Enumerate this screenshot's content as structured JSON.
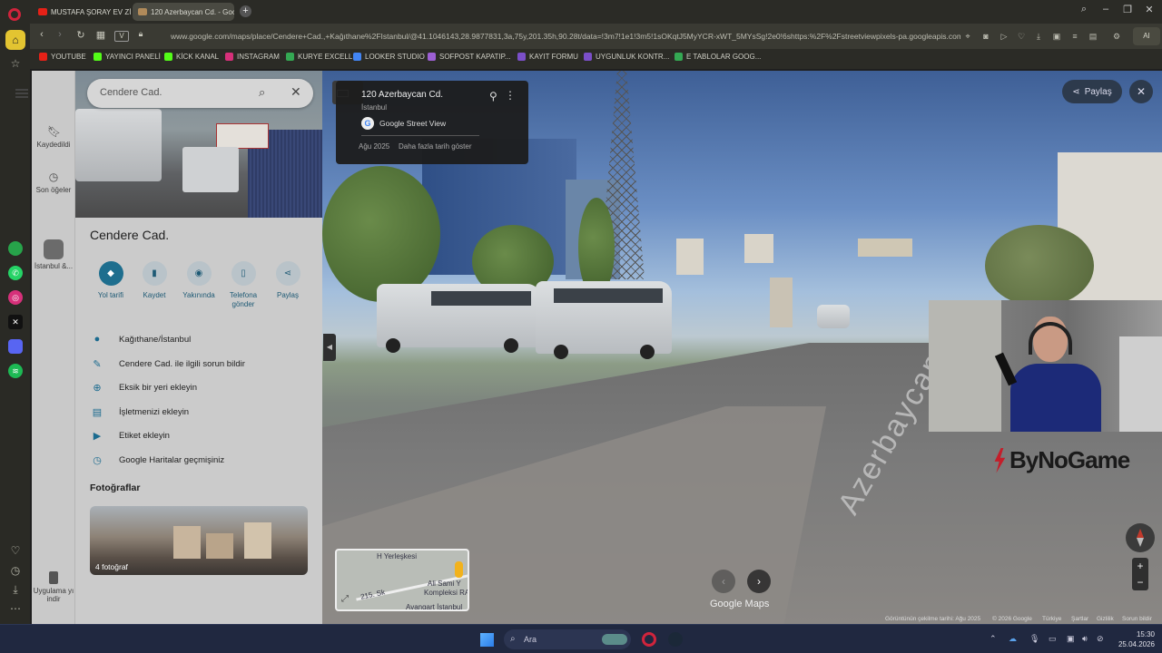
{
  "browser": {
    "tabs": [
      {
        "label": "MUSTAFA ŞORAY EV ZİYAR"
      },
      {
        "label": "120 Azerbaycan Cd. - Goo"
      }
    ],
    "url": "www.google.com/maps/place/Cendere+Cad.,+Kağıthane%2FIstanbul/@41.1046143,28.9877831,3a,75y,201.35h,90.28t/data=!3m7!1e1!3m5!1sOKqtJ5MyYCR-xWT_5MYsSg!2e0!6shttps:%2F%2Fstreetviewpixels-pa.googleapis.com",
    "ai_label": "AI",
    "bookmarks": [
      "YOUTUBE",
      "YAYINCI PANELİ",
      "KİCK KANAL",
      "INSTAGRAM",
      "KURYE EXCELL",
      "LOOKER STUDIO",
      "SOFPOST KAPATIP...",
      "KAYIT FORMU",
      "UYGUNLUK KONTR...",
      "E TABLOLAR GOOG..."
    ]
  },
  "maps": {
    "rail": {
      "saved": "Kaydedildi",
      "recent": "Son öğeler",
      "istanbul": "İstanbul &...",
      "install_app": "Uygulama yı indir"
    },
    "search": {
      "placeholder": "Cendere Cad."
    },
    "place": {
      "title": "Cendere Cad.",
      "actions": [
        "Yol tarifi",
        "Kaydet",
        "Yakınında",
        "Telefona gönder",
        "Paylaş"
      ],
      "info_rows": [
        "Kağıthane/İstanbul",
        "Cendere Cad. ile ilgili sorun bildir",
        "Eksik bir yeri ekleyin",
        "İşletmenizi ekleyin",
        "Etiket ekleyin",
        "Google Haritalar geçmişiniz"
      ],
      "photos_title": "Fotoğraflar",
      "photos_count": "4 fotoğraf"
    },
    "streetview": {
      "address": "120 Azerbaycan Cd.",
      "city": "İstanbul",
      "source": "Google Street View",
      "date": "Ağu 2025",
      "more_dates": "Daha fazla tarih göster",
      "share": "Paylaş",
      "road_marking": "Azerbaycan Cd.",
      "logo": "Google Maps",
      "minimap_labels": [
        "H Yerleşkesi",
        "Ali Sami Y",
        "Kompleksi RAM",
        "215. Sk",
        "Avangart İstanbul"
      ],
      "footer": [
        "Görüntünün çekilme tarihi: Ağu 2025",
        "© 2026 Google",
        "Türkiye",
        "Şartlar",
        "Gizlilik",
        "Sorun bildir"
      ]
    }
  },
  "overlay": {
    "brand": "ByNoGame"
  },
  "taskbar": {
    "search_placeholder": "Ara",
    "time": "15:30",
    "date": "25.04.2026"
  },
  "colors": {
    "accent_maps": "#1e6e8e",
    "opera_red": "#d0243c",
    "brand_red": "#c41e2a"
  }
}
